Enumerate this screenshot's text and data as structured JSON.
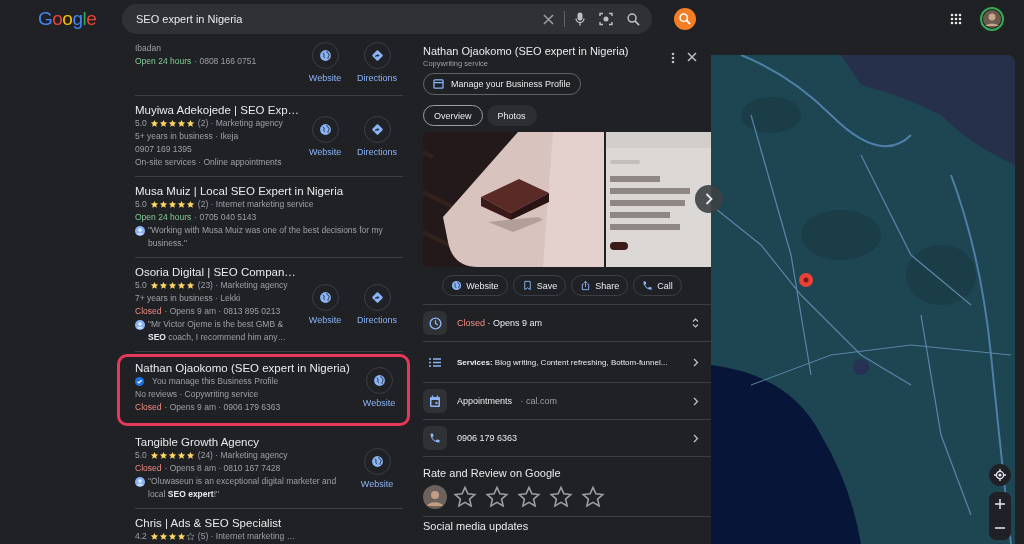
{
  "header": {
    "logo": "Google",
    "query": "SEO expert in Nigeria"
  },
  "results": [
    {
      "highlighted": false,
      "lines": [
        {
          "kind": "text",
          "text": "Ibadan"
        },
        {
          "kind": "status",
          "status": "Open 24 hours",
          "open": true,
          "text": "· 0808 166 0751"
        }
      ],
      "actions": [
        {
          "kind": "website",
          "label": "Website"
        },
        {
          "kind": "directions",
          "label": "Directions"
        }
      ]
    },
    {
      "highlighted": false,
      "title": "Muyiwa Adekojede | SEO Exp…",
      "lines": [
        {
          "kind": "rating",
          "rating": "5.0",
          "stars": 5,
          "text": "(2) · Marketing agency"
        },
        {
          "kind": "text",
          "text": "5+ years in business · Ikeja"
        },
        {
          "kind": "text",
          "text": "0907 169 1395"
        },
        {
          "kind": "text",
          "text": "On-site services · Online appointments"
        }
      ],
      "actions": [
        {
          "kind": "website",
          "label": "Website"
        },
        {
          "kind": "directions",
          "label": "Directions"
        }
      ]
    },
    {
      "highlighted": false,
      "title": "Musa Muiz | Local SEO Expert in Nigeria",
      "lines": [
        {
          "kind": "rating",
          "rating": "5.0",
          "stars": 5,
          "text": "(2) · Internet marketing service"
        },
        {
          "kind": "status",
          "status": "Open 24 hours",
          "open": true,
          "text": "· 0705 040 5143"
        },
        {
          "kind": "review",
          "text": "\"Working with Musa Muiz was one of the best decisions for my business.\""
        }
      ]
    },
    {
      "highlighted": false,
      "title": "Osoria Digital | SEO Compan…",
      "lines": [
        {
          "kind": "rating",
          "rating": "5.0",
          "stars": 5,
          "text": "(23) · Marketing agency"
        },
        {
          "kind": "text",
          "text": "7+ years in business · Lekki"
        },
        {
          "kind": "status",
          "status": "Closed",
          "open": false,
          "text": "· Opens 9 am · 0813 895 0213"
        },
        {
          "kind": "review",
          "text": "\"Mr Victor Ojeme is the best GMB & **SEO** coach, I recommend him any…"
        }
      ],
      "actions": [
        {
          "kind": "website",
          "label": "Website"
        },
        {
          "kind": "directions",
          "label": "Directions"
        }
      ]
    },
    {
      "highlighted": true,
      "title": "Nathan Ojaokomo (SEO expert in Nigeria)",
      "lines": [
        {
          "kind": "verified",
          "text": "You manage this Business Profile"
        },
        {
          "kind": "text",
          "text": "No reviews · Copywriting service"
        },
        {
          "kind": "status",
          "status": "Closed",
          "open": false,
          "text": "· Opens 9 am · 0906 179 6363"
        }
      ],
      "actions": [
        {
          "kind": "website",
          "label": "Website"
        }
      ]
    },
    {
      "highlighted": false,
      "title": "Tangible Growth Agency",
      "lines": [
        {
          "kind": "rating",
          "rating": "5.0",
          "stars": 5,
          "text": "(24) · Marketing agency"
        },
        {
          "kind": "status",
          "status": "Closed",
          "open": false,
          "text": "· Opens 8 am · 0810 167 7428"
        },
        {
          "kind": "review",
          "text": "\"Oluwaseun is an exceptional digital marketer and local **SEO expert**!\""
        }
      ],
      "actions": [
        {
          "kind": "website",
          "label": "Website"
        }
      ]
    },
    {
      "highlighted": false,
      "title": "Chris | Ads & SEO Specialist",
      "lines": [
        {
          "kind": "rating",
          "rating": "4.2",
          "stars": 4,
          "text": "(5) · Internet marketing …"
        }
      ]
    }
  ],
  "detail": {
    "title": "Nathan Ojaokomo (SEO expert in Nigeria)",
    "subtitle": "Copywriting service",
    "manage_button": "Manage your Business Profile",
    "tabs": [
      {
        "label": "Overview",
        "selected": true
      },
      {
        "label": "Photos",
        "selected": false
      }
    ],
    "photos": [
      {
        "kind": "picture"
      },
      {
        "kind": "picture"
      }
    ],
    "actions": [
      {
        "kind": "website",
        "label": "Website"
      },
      {
        "kind": "save",
        "label": "Save"
      },
      {
        "kind": "share",
        "label": "Share"
      },
      {
        "kind": "call",
        "label": "Call"
      }
    ],
    "info": [
      {
        "kind": "hours",
        "status": "Closed",
        "open": false,
        "text": "· Opens 9 am"
      },
      {
        "kind": "services",
        "text": "**Services:** Blog writing, Content refreshing, Bottom-funnel..."
      },
      {
        "kind": "appointments",
        "text": "Appointments",
        "link": "· cal.com"
      },
      {
        "kind": "phone",
        "text": "0906 179 6363"
      }
    ],
    "review_heading": "Rate and Review on Google",
    "stars": 0,
    "next_heading": "Social media updates"
  },
  "map": {
    "kind": "picture"
  }
}
